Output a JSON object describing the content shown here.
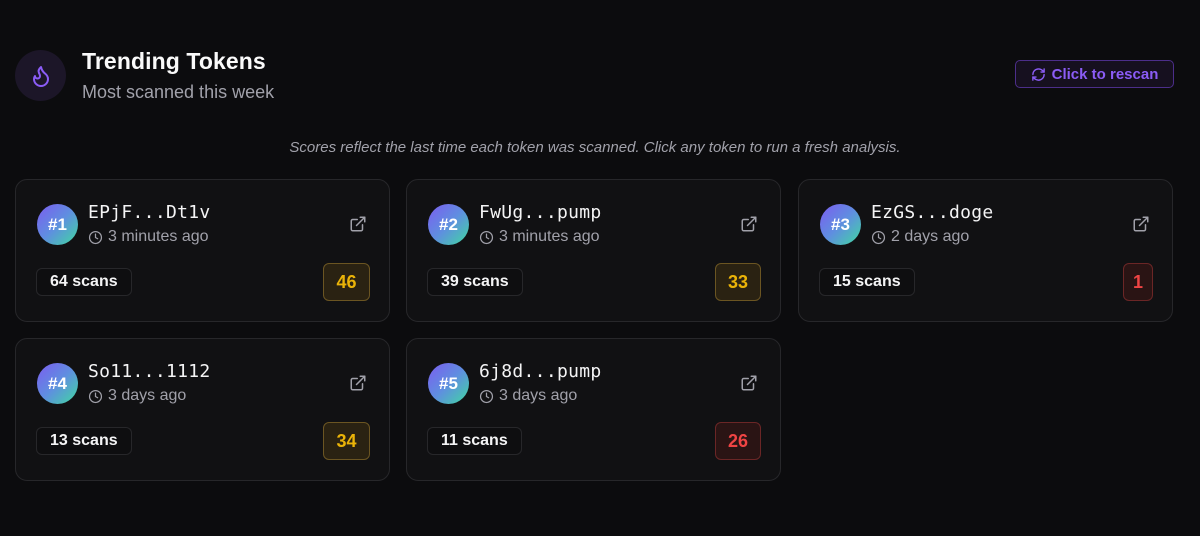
{
  "header": {
    "title": "Trending Tokens",
    "subtitle": "Most scanned this week",
    "icon": "flame-icon",
    "rescan_label": "Click to rescan",
    "rescan_icon": "refresh-icon"
  },
  "note": "Scores reflect the last time each token was scanned. Click any token to run a fresh analysis.",
  "colors": {
    "accent": "#8b5cf6",
    "score_mid": "#eab308",
    "score_low": "#ef4444"
  },
  "tokens": [
    {
      "rank": "#1",
      "address": "EPjF...Dt1v",
      "time": "3 minutes ago",
      "scans": "64 scans",
      "score": "46",
      "level": "mid"
    },
    {
      "rank": "#2",
      "address": "FwUg...pump",
      "time": "3 minutes ago",
      "scans": "39 scans",
      "score": "33",
      "level": "mid"
    },
    {
      "rank": "#3",
      "address": "EzGS...doge",
      "time": "2 days ago",
      "scans": "15 scans",
      "score": "1",
      "level": "low"
    },
    {
      "rank": "#4",
      "address": "So11...1112",
      "time": "3 days ago",
      "scans": "13 scans",
      "score": "34",
      "level": "mid"
    },
    {
      "rank": "#5",
      "address": "6j8d...pump",
      "time": "3 days ago",
      "scans": "11 scans",
      "score": "26",
      "level": "low"
    }
  ]
}
